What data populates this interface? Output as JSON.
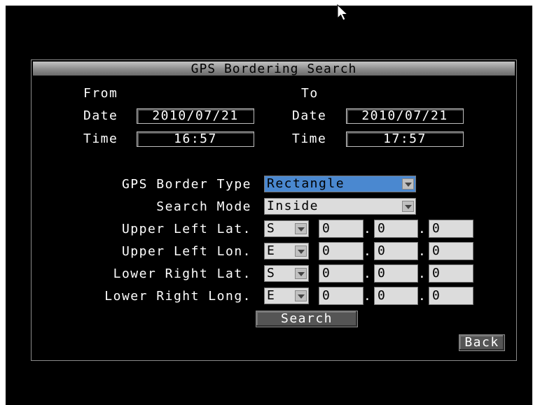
{
  "dialog": {
    "title": "GPS Bordering Search"
  },
  "from": {
    "header": "From",
    "date_label": "Date",
    "date_value": "2010/07/21",
    "time_label": "Time",
    "time_value": "16:57"
  },
  "to": {
    "header": "To",
    "date_label": "Date",
    "date_value": "2010/07/21",
    "time_label": "Time",
    "time_value": "17:57"
  },
  "border_type": {
    "label": "GPS Border Type",
    "value": "Rectangle"
  },
  "search_mode": {
    "label": "Search Mode",
    "value": "Inside"
  },
  "coords": [
    {
      "label": "Upper Left Lat.",
      "dir": "S",
      "deg": "0",
      "min": "0",
      "sec": "0"
    },
    {
      "label": "Upper Left Lon.",
      "dir": "E",
      "deg": "0",
      "min": "0",
      "sec": "0"
    },
    {
      "label": "Lower Right Lat.",
      "dir": "S",
      "deg": "0",
      "min": "0",
      "sec": "0"
    },
    {
      "label": "Lower Right Long.",
      "dir": "E",
      "deg": "0",
      "min": "0",
      "sec": "0"
    }
  ],
  "separator": ".",
  "buttons": {
    "search": "Search",
    "back": "Back"
  }
}
